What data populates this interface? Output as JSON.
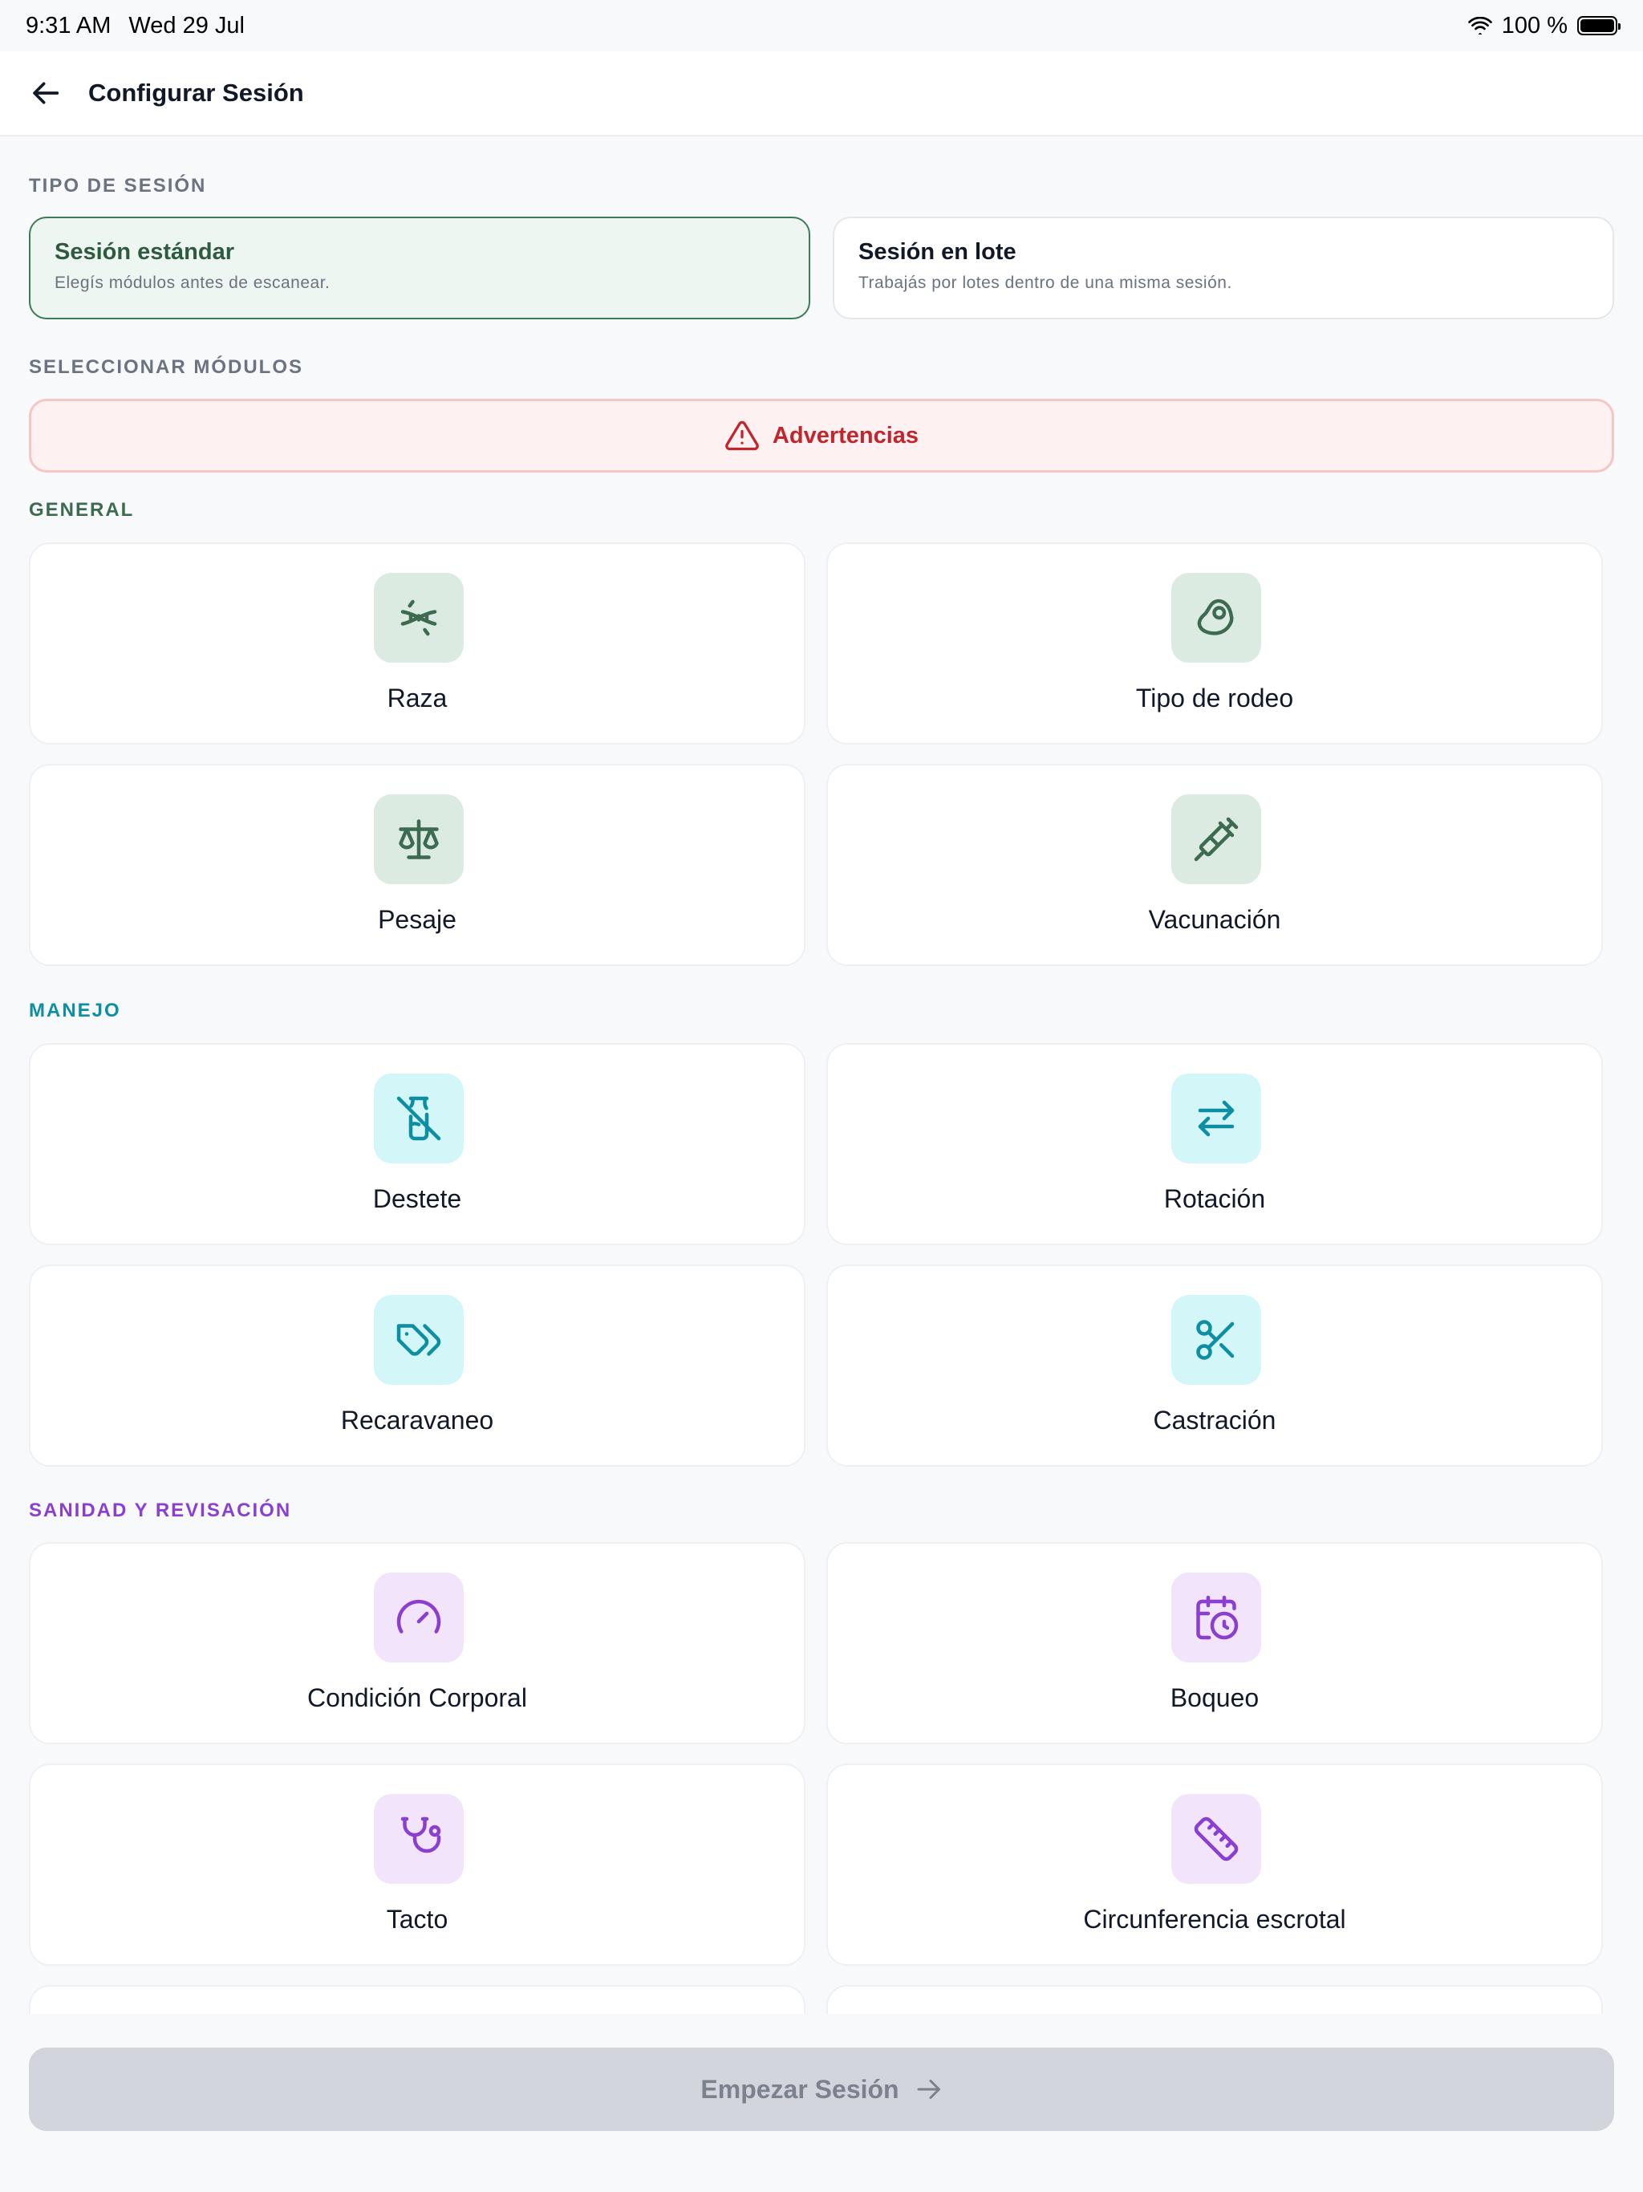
{
  "status_bar": {
    "time": "9:31 AM",
    "date": "Wed 29 Jul",
    "battery": "100 %"
  },
  "header": {
    "title": "Configurar Sesión"
  },
  "session_type": {
    "label": "TIPO DE SESIÓN",
    "options": [
      {
        "name": "Sesión estándar",
        "desc": "Elegís módulos antes de escanear.",
        "selected": true
      },
      {
        "name": "Sesión en lote",
        "desc": "Trabajás por lotes dentro de una misma sesión.",
        "selected": false
      }
    ]
  },
  "modules": {
    "label": "SELECCIONAR MÓDULOS",
    "warning": "Advertencias",
    "groups": [
      {
        "label": "GENERAL",
        "color": "#3d6b50",
        "items": [
          {
            "label": "Raza",
            "icon": "dna-icon"
          },
          {
            "label": "Tipo de rodeo",
            "icon": "beef-icon"
          },
          {
            "label": "Pesaje",
            "icon": "scale-icon"
          },
          {
            "label": "Vacunación",
            "icon": "syringe-icon"
          }
        ]
      },
      {
        "label": "MANEJO",
        "color": "#0e8ea3",
        "items": [
          {
            "label": "Destete",
            "icon": "milk-off-icon"
          },
          {
            "label": "Rotación",
            "icon": "arrows-swap-icon"
          },
          {
            "label": "Recaravaneo",
            "icon": "tags-icon"
          },
          {
            "label": "Castración",
            "icon": "scissors-icon"
          }
        ]
      },
      {
        "label": "SANIDAD Y REVISACIÓN",
        "color": "#8a3fd1",
        "items": [
          {
            "label": "Condición Corporal",
            "icon": "gauge-icon"
          },
          {
            "label": "Boqueo",
            "icon": "calendar-clock-icon"
          },
          {
            "label": "Tacto",
            "icon": "stethoscope-icon"
          },
          {
            "label": "Circunferencia escrotal",
            "icon": "ruler-icon"
          }
        ]
      }
    ]
  },
  "footer": {
    "start_label": "Empezar Sesión"
  }
}
